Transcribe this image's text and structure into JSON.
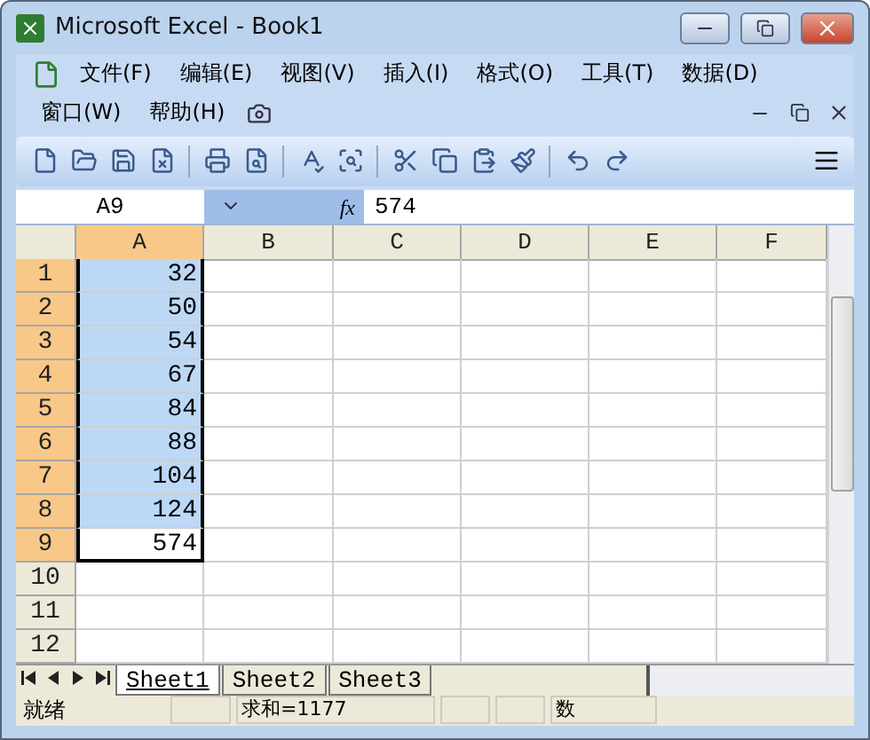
{
  "window": {
    "title": "Microsoft Excel - Book1"
  },
  "menu_rows": [
    [
      "文件(F)",
      "编辑(E)",
      "视图(V)",
      "插入(I)",
      "格式(O)",
      "工具(T)",
      "数据(D)"
    ],
    [
      "窗口(W)",
      "帮助(H)"
    ]
  ],
  "formula_bar": {
    "name_box": "A9",
    "function_label": "fx",
    "formula": "574"
  },
  "columns": [
    {
      "label": "A",
      "selected": true
    },
    {
      "label": "B",
      "selected": false
    },
    {
      "label": "C",
      "selected": false
    },
    {
      "label": "D",
      "selected": false
    },
    {
      "label": "E",
      "selected": false
    },
    {
      "label": "F",
      "selected": false
    }
  ],
  "rows": [
    {
      "label": "1",
      "selected": true,
      "active": false,
      "value": "32"
    },
    {
      "label": "2",
      "selected": true,
      "active": false,
      "value": "50"
    },
    {
      "label": "3",
      "selected": true,
      "active": false,
      "value": "54"
    },
    {
      "label": "4",
      "selected": true,
      "active": false,
      "value": "67"
    },
    {
      "label": "5",
      "selected": true,
      "active": false,
      "value": "84"
    },
    {
      "label": "6",
      "selected": true,
      "active": false,
      "value": "88"
    },
    {
      "label": "7",
      "selected": true,
      "active": false,
      "value": "104"
    },
    {
      "label": "8",
      "selected": true,
      "active": false,
      "value": "124"
    },
    {
      "label": "9",
      "selected": true,
      "active": true,
      "value": "574"
    },
    {
      "label": "10",
      "selected": false,
      "active": false
    },
    {
      "label": "11",
      "selected": false,
      "active": false
    },
    {
      "label": "12",
      "selected": false,
      "active": false
    }
  ],
  "sheets": [
    {
      "label": "Sheet1",
      "selected": true
    },
    {
      "label": "Sheet2",
      "selected": false
    },
    {
      "label": "Sheet3",
      "selected": false
    }
  ],
  "status_bar": {
    "state": "就绪",
    "sum": "求和=1177",
    "mode": "数"
  }
}
